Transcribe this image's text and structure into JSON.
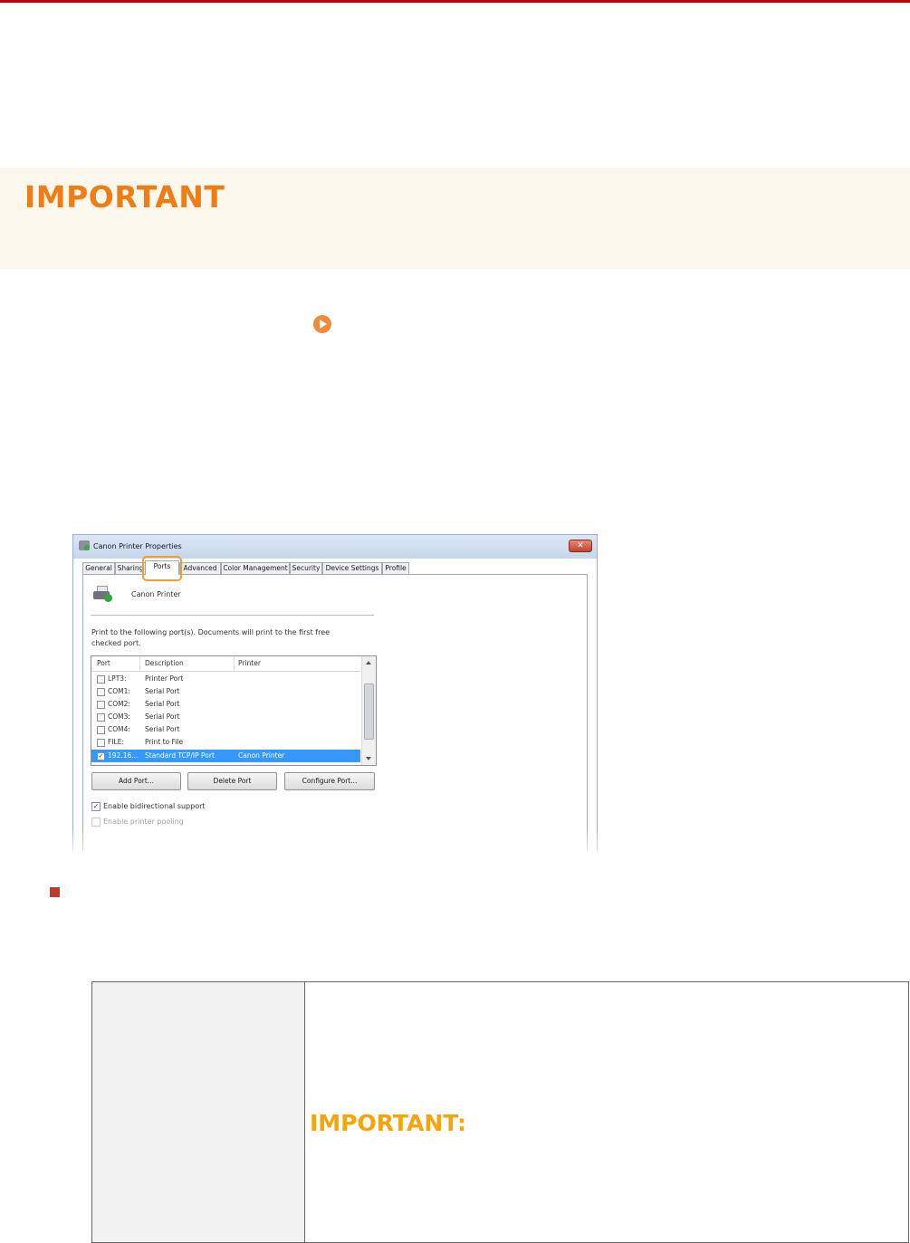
{
  "important_banner": {
    "title": "IMPORTANT"
  },
  "dialog": {
    "title": "Canon Printer Properties",
    "close_glyph": "✕",
    "tabs": [
      "General",
      "Sharing",
      "Ports",
      "Advanced",
      "Color Management",
      "Security",
      "Device Settings",
      "Profile"
    ],
    "active_tab": "Ports",
    "printer_name": "Canon Printer",
    "instruction_line1": "Print to the following port(s). Documents will print to the first free",
    "instruction_line2": "checked port.",
    "columns": {
      "port": "Port",
      "description": "Description",
      "printer": "Printer"
    },
    "ports": [
      {
        "port": "LPT3:",
        "description": "Printer Port",
        "printer": "",
        "checked": false,
        "selected": false
      },
      {
        "port": "COM1:",
        "description": "Serial Port",
        "printer": "",
        "checked": false,
        "selected": false
      },
      {
        "port": "COM2:",
        "description": "Serial Port",
        "printer": "",
        "checked": false,
        "selected": false
      },
      {
        "port": "COM3:",
        "description": "Serial Port",
        "printer": "",
        "checked": false,
        "selected": false
      },
      {
        "port": "COM4:",
        "description": "Serial Port",
        "printer": "",
        "checked": false,
        "selected": false
      },
      {
        "port": "FILE:",
        "description": "Print to File",
        "printer": "",
        "checked": false,
        "selected": false
      },
      {
        "port": "192.16...",
        "description": "Standard TCP/IP Port",
        "printer": "Canon Printer",
        "checked": true,
        "selected": true
      }
    ],
    "buttons": {
      "add_port": "Add Port...",
      "delete_port": "Delete Port",
      "configure_port": "Configure Port..."
    },
    "bidirectional_label": "Enable bidirectional support",
    "bidirectional_checked": true,
    "pooling_label": "Enable printer pooling",
    "pooling_checked": false,
    "check_glyph": "✓"
  },
  "table": {
    "important_label": "IMPORTANT:"
  },
  "colors": {
    "accent_orange": "#f07d14",
    "rule_red": "#c00000",
    "important_yellow": "#f5a40b",
    "selection_blue": "#3399ff"
  }
}
